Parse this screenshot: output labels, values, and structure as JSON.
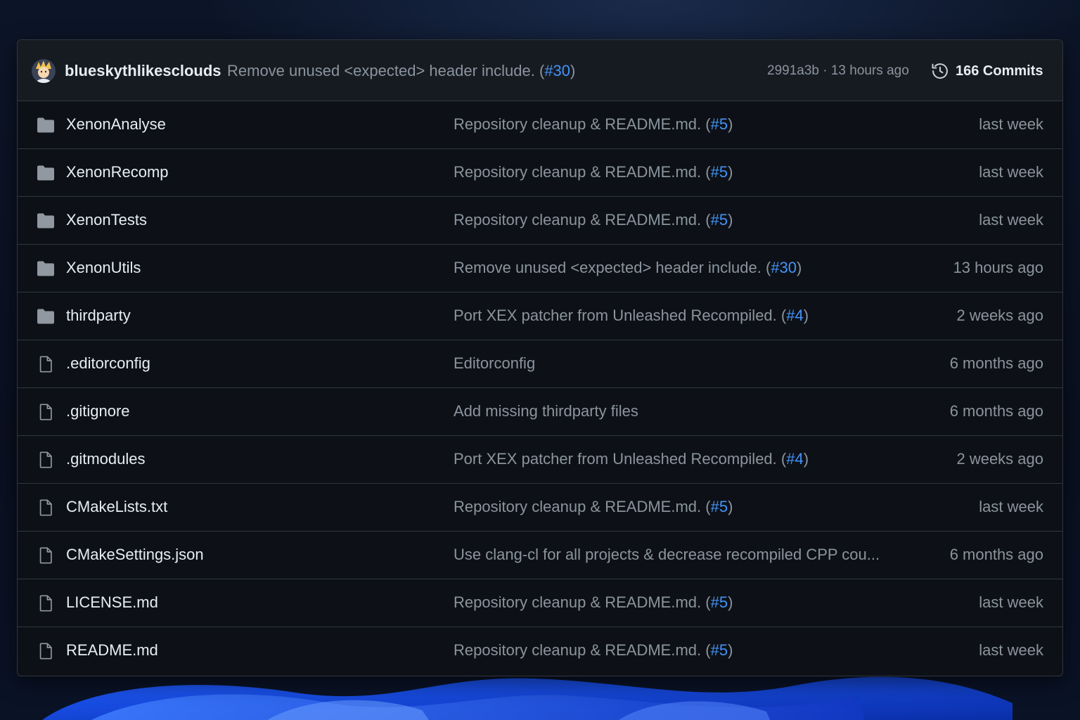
{
  "latest_commit": {
    "author": "blueskythlikesclouds",
    "message": "Remove unused <expected> header include. (",
    "pr_link": "#30",
    "message_close": ")",
    "sha": "2991a3b",
    "separator": "·",
    "time": "13 hours ago",
    "commits_label": "166 Commits"
  },
  "files": [
    {
      "type": "folder",
      "icon": "folder-icon",
      "name": "XenonAnalyse",
      "message": "Repository cleanup & README.md. (",
      "pr": "#5",
      "close": ")",
      "time": "last week"
    },
    {
      "type": "folder",
      "icon": "folder-icon",
      "name": "XenonRecomp",
      "message": "Repository cleanup & README.md. (",
      "pr": "#5",
      "close": ")",
      "time": "last week"
    },
    {
      "type": "folder",
      "icon": "folder-icon",
      "name": "XenonTests",
      "message": "Repository cleanup & README.md. (",
      "pr": "#5",
      "close": ")",
      "time": "last week"
    },
    {
      "type": "folder",
      "icon": "folder-icon",
      "name": "XenonUtils",
      "message": "Remove unused <expected> header include. (",
      "pr": "#30",
      "close": ")",
      "time": "13 hours ago"
    },
    {
      "type": "folder",
      "icon": "folder-icon",
      "name": "thirdparty",
      "message": "Port XEX patcher from Unleashed Recompiled. (",
      "pr": "#4",
      "close": ")",
      "time": "2 weeks ago"
    },
    {
      "type": "file",
      "icon": "file-icon",
      "name": ".editorconfig",
      "message": "Editorconfig",
      "pr": "",
      "close": "",
      "time": "6 months ago"
    },
    {
      "type": "file",
      "icon": "file-icon",
      "name": ".gitignore",
      "message": "Add missing thirdparty files",
      "pr": "",
      "close": "",
      "time": "6 months ago"
    },
    {
      "type": "file",
      "icon": "file-icon",
      "name": ".gitmodules",
      "message": "Port XEX patcher from Unleashed Recompiled. (",
      "pr": "#4",
      "close": ")",
      "time": "2 weeks ago"
    },
    {
      "type": "file",
      "icon": "file-icon",
      "name": "CMakeLists.txt",
      "message": "Repository cleanup & README.md. (",
      "pr": "#5",
      "close": ")",
      "time": "last week"
    },
    {
      "type": "file",
      "icon": "file-icon",
      "name": "CMakeSettings.json",
      "message": "Use clang-cl for all projects & decrease recompiled CPP cou...",
      "pr": "",
      "close": "",
      "time": "6 months ago"
    },
    {
      "type": "file",
      "icon": "file-icon",
      "name": "LICENSE.md",
      "message": "Repository cleanup & README.md. (",
      "pr": "#5",
      "close": ")",
      "time": "last week"
    },
    {
      "type": "file",
      "icon": "file-icon",
      "name": "README.md",
      "message": "Repository cleanup & README.md. (",
      "pr": "#5",
      "close": ")",
      "time": "last week"
    }
  ],
  "colors": {
    "panel_bg": "#0d1117",
    "header_bg": "#161b22",
    "border": "#30363d",
    "text_primary": "#e6edf3",
    "text_muted": "#8b949e",
    "link": "#4493f8",
    "icon": "#8b949e"
  }
}
